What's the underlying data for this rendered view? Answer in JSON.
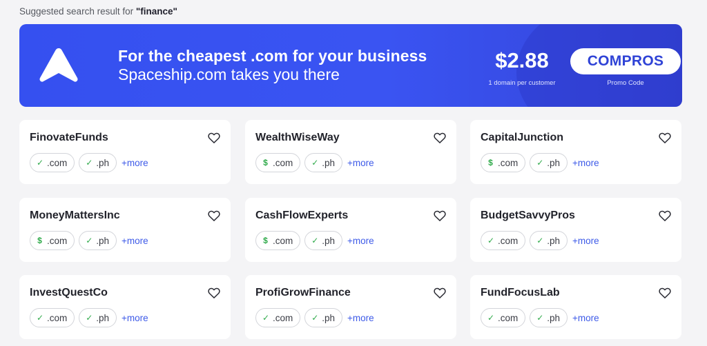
{
  "query": {
    "prefix": "Suggested search result for ",
    "term": "\"finance\""
  },
  "banner": {
    "headline": "For the cheapest .com for your business",
    "subline": "Spaceship.com takes you there",
    "price": "$2.88",
    "price_note": "1 domain per customer",
    "promo_code": "COMPROS",
    "promo_note": "Promo Code",
    "brand_color": "#3550f0"
  },
  "colors": {
    "available": "#2faa4a",
    "link": "#3d5ae8",
    "card_bg": "#ffffff",
    "page_bg": "#f4f4f6"
  },
  "cards": [
    {
      "name": "FinovateFunds",
      "tlds": [
        {
          "tld": ".com",
          "status": "available",
          "mark": "✓"
        },
        {
          "tld": ".ph",
          "status": "available",
          "mark": "✓"
        }
      ],
      "more": "+more"
    },
    {
      "name": "WealthWiseWay",
      "tlds": [
        {
          "tld": ".com",
          "status": "premium",
          "mark": "$"
        },
        {
          "tld": ".ph",
          "status": "available",
          "mark": "✓"
        }
      ],
      "more": "+more"
    },
    {
      "name": "CapitalJunction",
      "tlds": [
        {
          "tld": ".com",
          "status": "premium",
          "mark": "$"
        },
        {
          "tld": ".ph",
          "status": "available",
          "mark": "✓"
        }
      ],
      "more": "+more"
    },
    {
      "name": "MoneyMattersInc",
      "tlds": [
        {
          "tld": ".com",
          "status": "premium",
          "mark": "$"
        },
        {
          "tld": ".ph",
          "status": "available",
          "mark": "✓"
        }
      ],
      "more": "+more"
    },
    {
      "name": "CashFlowExperts",
      "tlds": [
        {
          "tld": ".com",
          "status": "premium",
          "mark": "$"
        },
        {
          "tld": ".ph",
          "status": "available",
          "mark": "✓"
        }
      ],
      "more": "+more"
    },
    {
      "name": "BudgetSavvyPros",
      "tlds": [
        {
          "tld": ".com",
          "status": "available",
          "mark": "✓"
        },
        {
          "tld": ".ph",
          "status": "available",
          "mark": "✓"
        }
      ],
      "more": "+more"
    },
    {
      "name": "InvestQuestCo",
      "tlds": [
        {
          "tld": ".com",
          "status": "available",
          "mark": "✓"
        },
        {
          "tld": ".ph",
          "status": "available",
          "mark": "✓"
        }
      ],
      "more": "+more"
    },
    {
      "name": "ProfiGrowFinance",
      "tlds": [
        {
          "tld": ".com",
          "status": "available",
          "mark": "✓"
        },
        {
          "tld": ".ph",
          "status": "available",
          "mark": "✓"
        }
      ],
      "more": "+more"
    },
    {
      "name": "FundFocusLab",
      "tlds": [
        {
          "tld": ".com",
          "status": "available",
          "mark": "✓"
        },
        {
          "tld": ".ph",
          "status": "available",
          "mark": "✓"
        }
      ],
      "more": "+more"
    }
  ]
}
